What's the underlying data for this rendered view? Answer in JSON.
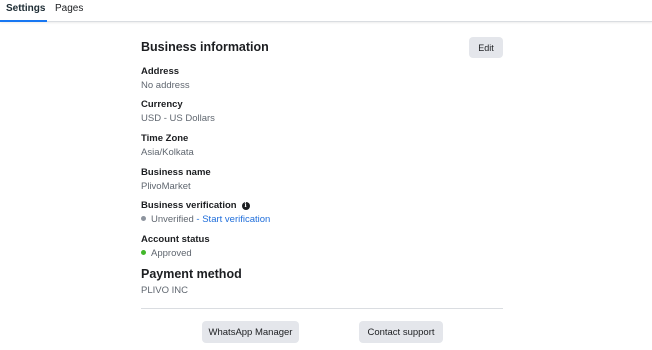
{
  "tabs": [
    {
      "label": "Settings",
      "active": true
    },
    {
      "label": "Pages",
      "active": false
    }
  ],
  "business_info": {
    "title": "Business information",
    "edit_label": "Edit",
    "fields": {
      "address": {
        "label": "Address",
        "value": "No address"
      },
      "currency": {
        "label": "Currency",
        "value": "USD - US Dollars"
      },
      "timezone": {
        "label": "Time Zone",
        "value": "Asia/Kolkata"
      },
      "business_name": {
        "label": "Business name",
        "value": "PlivoMarket"
      },
      "verification": {
        "label": "Business verification",
        "status": "Unverified",
        "action": "- Start verification",
        "status_color": "#8d949e"
      },
      "account_status": {
        "label": "Account status",
        "value": "Approved",
        "status_color": "#42b72a"
      }
    }
  },
  "payment": {
    "title": "Payment method",
    "value": "PLIVO INC"
  },
  "footer": {
    "whatsapp_manager_label": "WhatsApp Manager",
    "contact_support_label": "Contact support"
  },
  "colors": {
    "accent": "#1877f2",
    "link": "#216fdb"
  },
  "icons": {
    "verification_info": "info-icon"
  }
}
